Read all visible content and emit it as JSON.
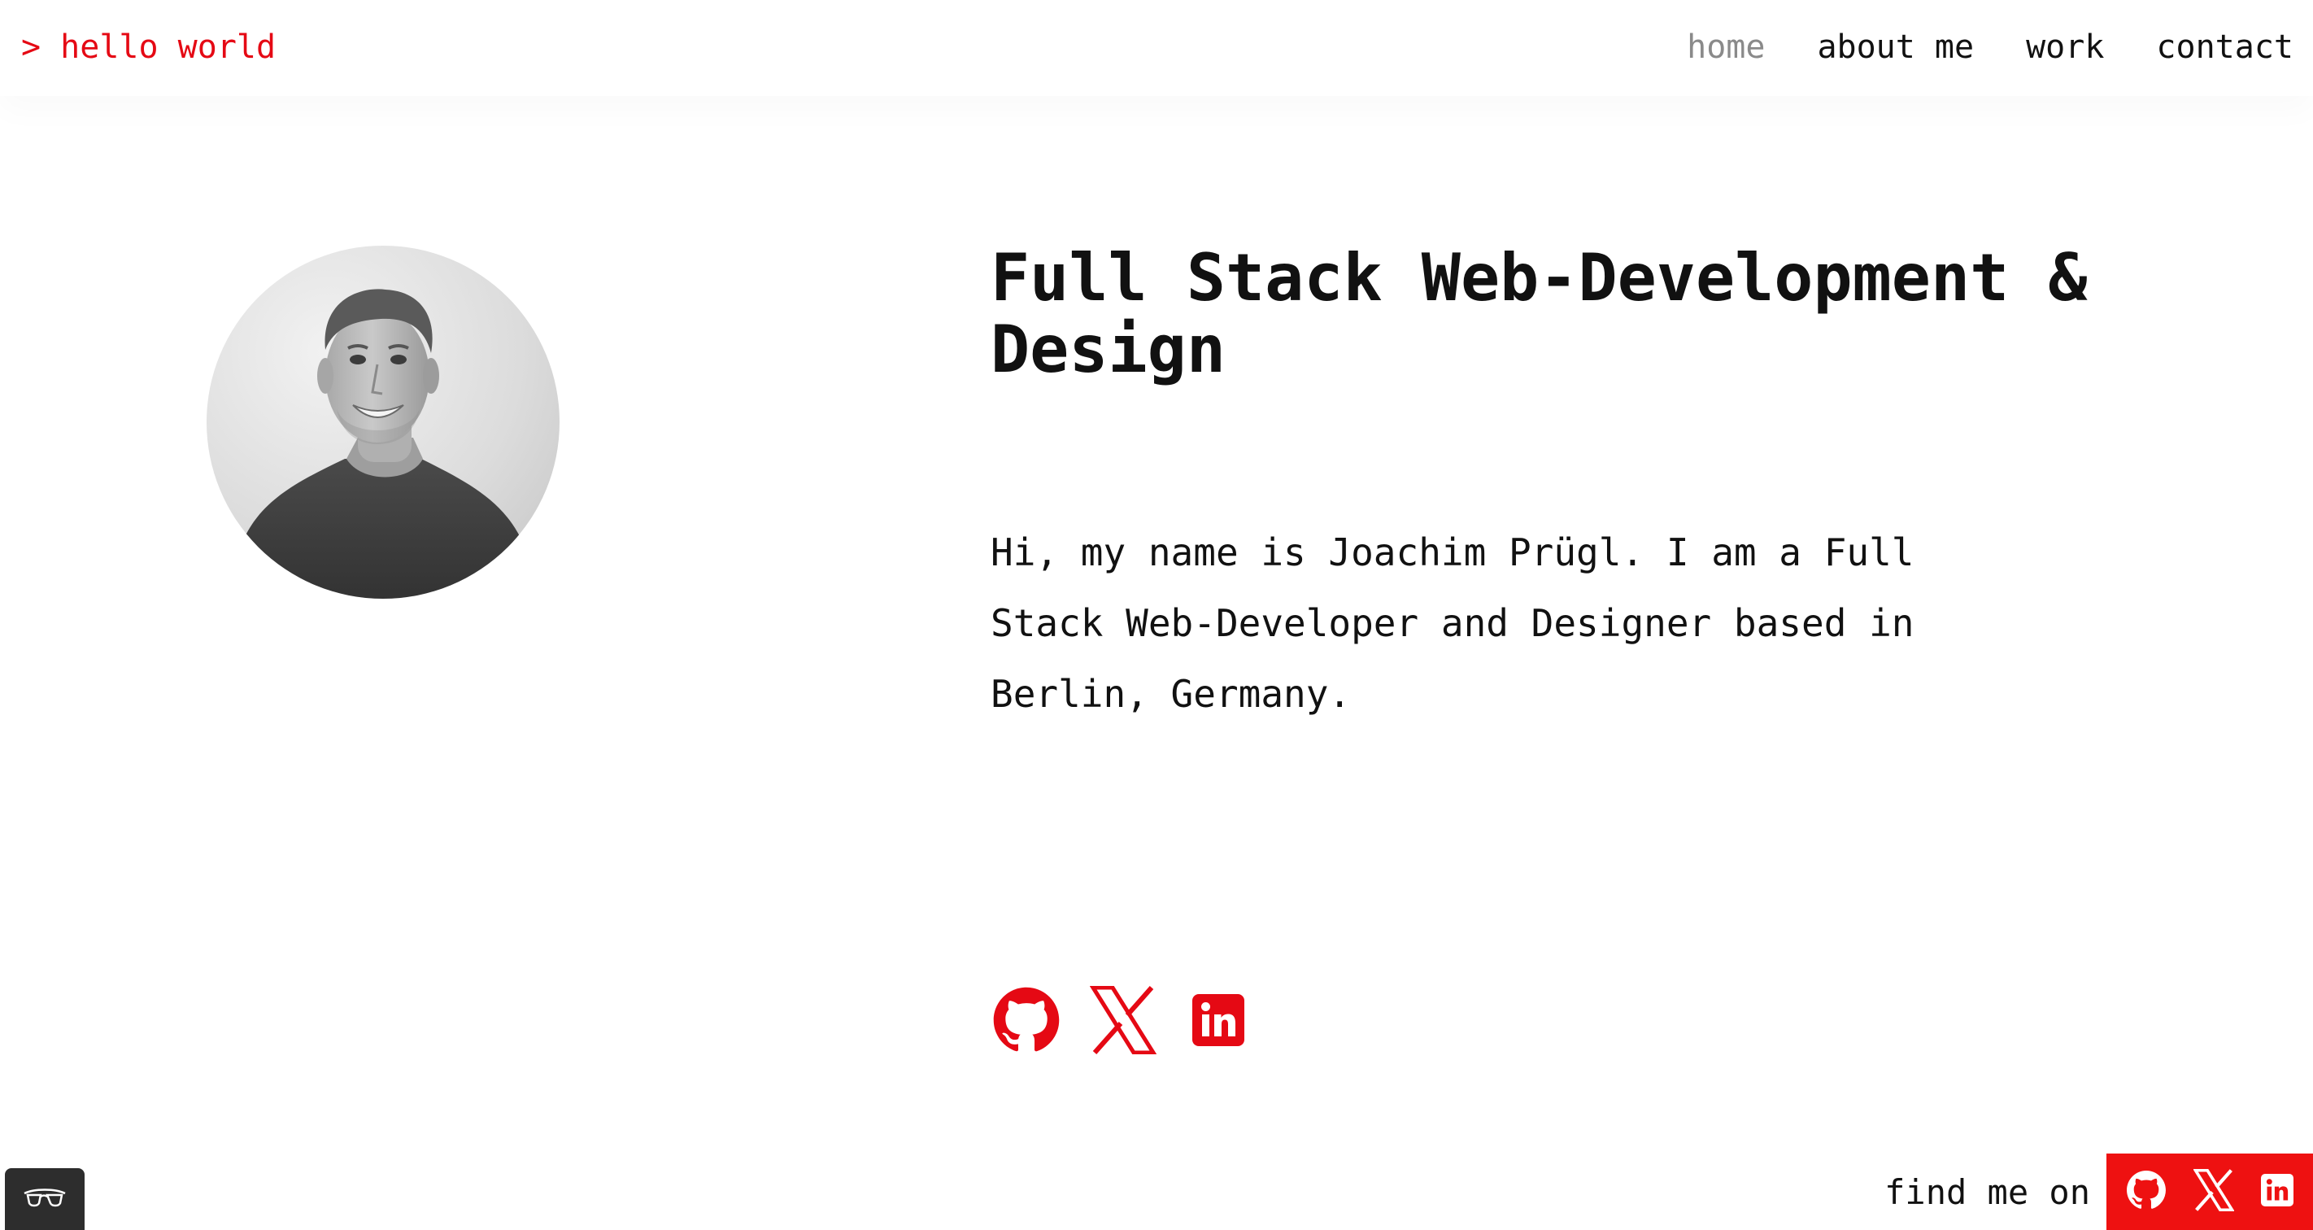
{
  "header": {
    "logo": "> hello world",
    "nav": [
      {
        "label": "home",
        "active": true
      },
      {
        "label": "about me",
        "active": false
      },
      {
        "label": "work",
        "active": false
      },
      {
        "label": "contact",
        "active": false
      }
    ]
  },
  "hero": {
    "headline": "Full Stack Web-Development & Design",
    "intro": "Hi, my name is Joachim Prügl. I am a Full Stack Web-Developer and Designer based in Berlin, Germany.",
    "social_icons": [
      "github-icon",
      "x-icon",
      "linkedin-icon"
    ]
  },
  "footer": {
    "find_label": "find me on",
    "social_icons": [
      "github-icon",
      "x-icon",
      "linkedin-icon"
    ],
    "a11y_icon": "glasses-icon"
  },
  "colors": {
    "accent": "#e50914",
    "footer_bar": "#ee1111",
    "text": "#111111",
    "nav_active": "#8a8a8a",
    "a11y_button": "#2d2d2d"
  }
}
